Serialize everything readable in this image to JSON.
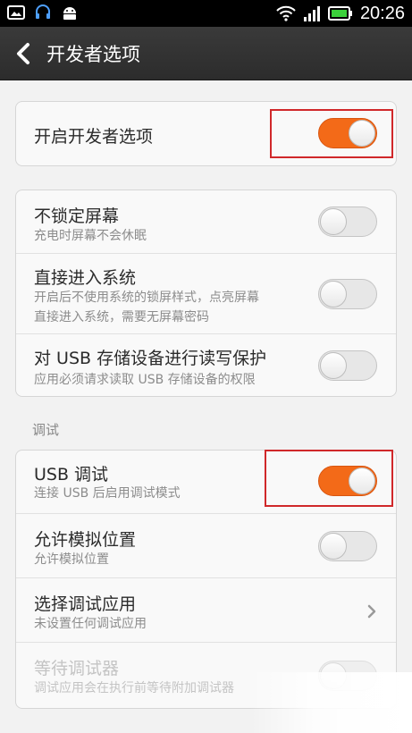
{
  "status_bar": {
    "time": "20:26",
    "left_icons": [
      "image-icon",
      "headset-icon",
      "android-icon"
    ],
    "right_icons": [
      "wifi-icon",
      "signal-icon",
      "battery-icon"
    ]
  },
  "action_bar": {
    "title": "开发者选项"
  },
  "master": {
    "label": "开启开发者选项",
    "enabled": true
  },
  "group1": [
    {
      "title": "不锁定屏幕",
      "summary": [
        "充电时屏幕不会休眠"
      ],
      "enabled": false
    },
    {
      "title": "直接进入系统",
      "summary": [
        "开启后不使用系统的锁屏样式，点亮屏幕",
        "直接进入系统，需要无屏幕密码"
      ],
      "enabled": false
    },
    {
      "title": "对 USB 存储设备进行读写保护",
      "summary": [
        "应用必须请求读取 USB 存储设备的权限"
      ],
      "enabled": false
    }
  ],
  "debug_section": {
    "header": "调试",
    "items": [
      {
        "title": "USB 调试",
        "summary": "连接 USB 后启用调试模式",
        "enabled": true
      },
      {
        "title": "允许模拟位置",
        "summary": "允许模拟位置",
        "enabled": false
      },
      {
        "title": "选择调试应用",
        "summary": "未设置任何调试应用"
      },
      {
        "title": "等待调试器",
        "summary": "调试应用会在执行前等待附加调试器",
        "enabled": false
      }
    ]
  },
  "colors": {
    "accent": "#f36a18",
    "highlight": "#d0282a",
    "actionbar": "#2f2f2f"
  }
}
